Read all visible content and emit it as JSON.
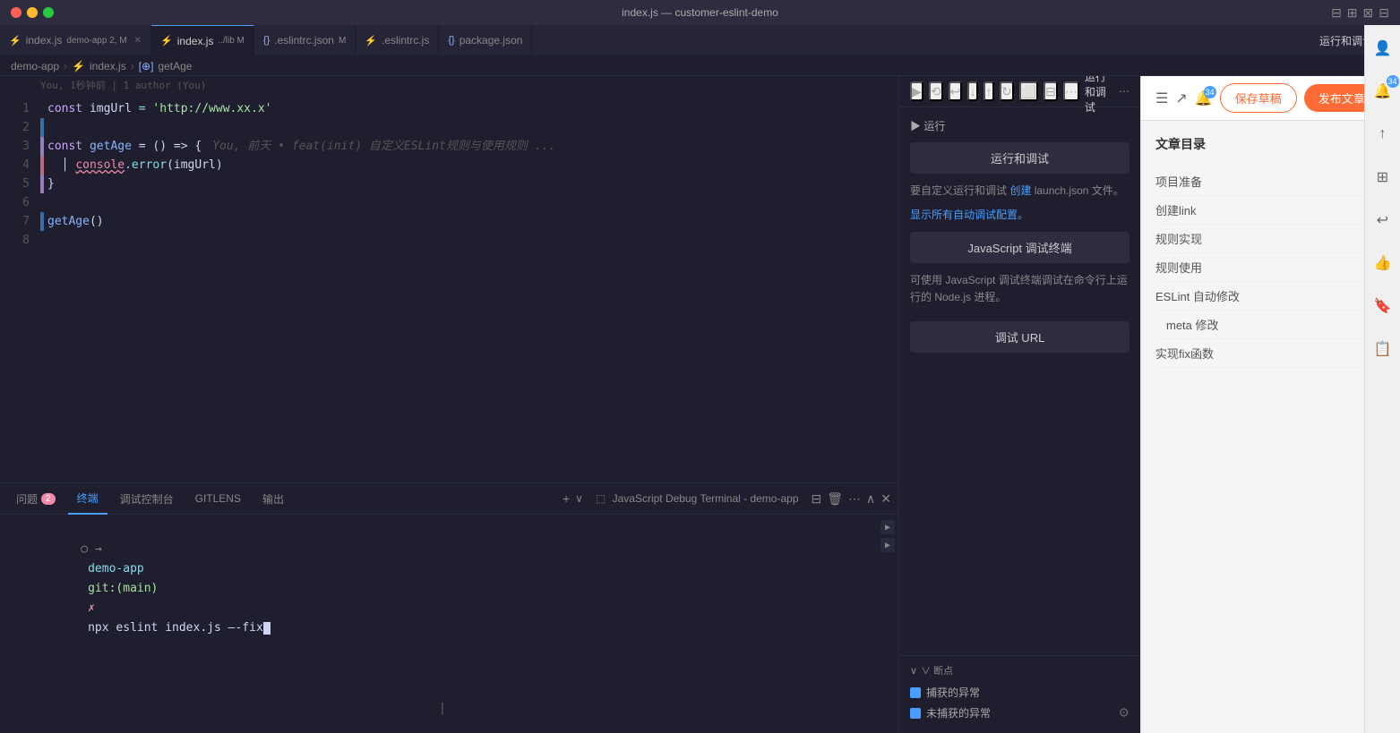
{
  "titlebar": {
    "title": "index.js — customer-eslint-demo",
    "icons": [
      "split-horizontal",
      "split-vertical",
      "split-grid",
      "layout"
    ]
  },
  "tabs": [
    {
      "id": "tab1",
      "icon": "⚡",
      "label": "index.js",
      "context": "demo-app",
      "badge": "2, M",
      "active": false,
      "modified": false,
      "closeable": true
    },
    {
      "id": "tab2",
      "icon": "⚡",
      "label": "index.js",
      "context": "../lib",
      "badge": "M",
      "active": true,
      "modified": false,
      "closeable": false
    },
    {
      "id": "tab3",
      "icon": "{}",
      "label": ".eslintrc.json",
      "badge": "M",
      "active": false,
      "modified": false,
      "closeable": false
    },
    {
      "id": "tab4",
      "icon": "⚡",
      "label": ".eslintrc.js",
      "active": false,
      "closeable": false
    },
    {
      "id": "tab5",
      "icon": "{}",
      "label": "package.json",
      "active": false,
      "closeable": false
    }
  ],
  "tab_actions_label": "运行和调试",
  "breadcrumb": {
    "parts": [
      "demo-app",
      "index.js",
      "getAge"
    ]
  },
  "editor": {
    "lines": [
      {
        "num": 1,
        "tokens": [
          {
            "type": "kw",
            "text": "const "
          },
          {
            "type": "var",
            "text": "imgUrl"
          },
          {
            "type": "op",
            "text": " = "
          },
          {
            "type": "str",
            "text": "'http://www.xx.x'"
          }
        ]
      },
      {
        "num": 2,
        "tokens": []
      },
      {
        "num": 3,
        "tokens": [
          {
            "type": "kw",
            "text": "const "
          },
          {
            "type": "fn",
            "text": "getAge"
          },
          {
            "type": "punc",
            "text": " = () => {"
          },
          {
            "type": "ghost",
            "text": "  You, 前天 • feat(init) 自定义ESLint规则与使用规则 ..."
          }
        ]
      },
      {
        "num": 4,
        "tokens": [
          {
            "type": "punc",
            "text": "  "
          },
          {
            "type": "err",
            "text": "console"
          },
          {
            "type": "method",
            "text": ".error"
          },
          {
            "type": "punc",
            "text": "(imgUrl)"
          }
        ],
        "has_error": true
      },
      {
        "num": 5,
        "tokens": [
          {
            "type": "punc",
            "text": "}"
          }
        ]
      },
      {
        "num": 6,
        "tokens": []
      },
      {
        "num": 7,
        "tokens": [
          {
            "type": "fn",
            "text": "getAge"
          },
          {
            "type": "punc",
            "text": "()"
          }
        ]
      },
      {
        "num": 8,
        "tokens": []
      }
    ],
    "git_info": "You, 1秒钟前 | 1 author (You)"
  },
  "debug_panel": {
    "header_title": "运行和调试",
    "section_title": "▶ 运行",
    "run_debug_btn": "运行和调试",
    "create_link_text": "创建",
    "create_desc_before": "要自定义运行和调试",
    "create_desc_after": "launch.json 文件。",
    "show_all_link": "显示所有自动调试配置。",
    "js_terminal_btn": "JavaScript 调试终端",
    "js_desc": "可使用 JavaScript 调试终端调试在命令行上运行的 Node.js 进程。",
    "debug_url_btn": "调试 URL",
    "breakpoints_header": "∨ 断点",
    "bp_caught": "捕获的异常",
    "bp_uncaught": "未捕获的异常"
  },
  "right_panel": {
    "save_btn": "保存草稿",
    "publish_btn": "发布文章",
    "toc_title": "文章目录",
    "toc_items": [
      {
        "label": "项目准备",
        "sub": false
      },
      {
        "label": "创建link",
        "sub": false
      },
      {
        "label": "规则实现",
        "sub": false
      },
      {
        "label": "规则使用",
        "sub": false
      },
      {
        "label": "ESLint 自动修改",
        "sub": false
      },
      {
        "label": "meta 修改",
        "sub": true
      },
      {
        "label": "实现fix函数",
        "sub": false
      }
    ]
  },
  "bottom_panel": {
    "tabs": [
      {
        "label": "问题",
        "badge": "2",
        "active": false
      },
      {
        "label": "终端",
        "badge": null,
        "active": true
      },
      {
        "label": "调试控制台",
        "badge": null,
        "active": false
      },
      {
        "label": "GITLENS",
        "badge": null,
        "active": false
      },
      {
        "label": "输出",
        "badge": null,
        "active": false
      }
    ],
    "terminal_label": "JavaScript Debug Terminal - demo-app",
    "terminal_lines": [
      {
        "text": "demo-app git:(main) ✗ npx eslint index.js —-fix",
        "prompt": true
      }
    ]
  }
}
